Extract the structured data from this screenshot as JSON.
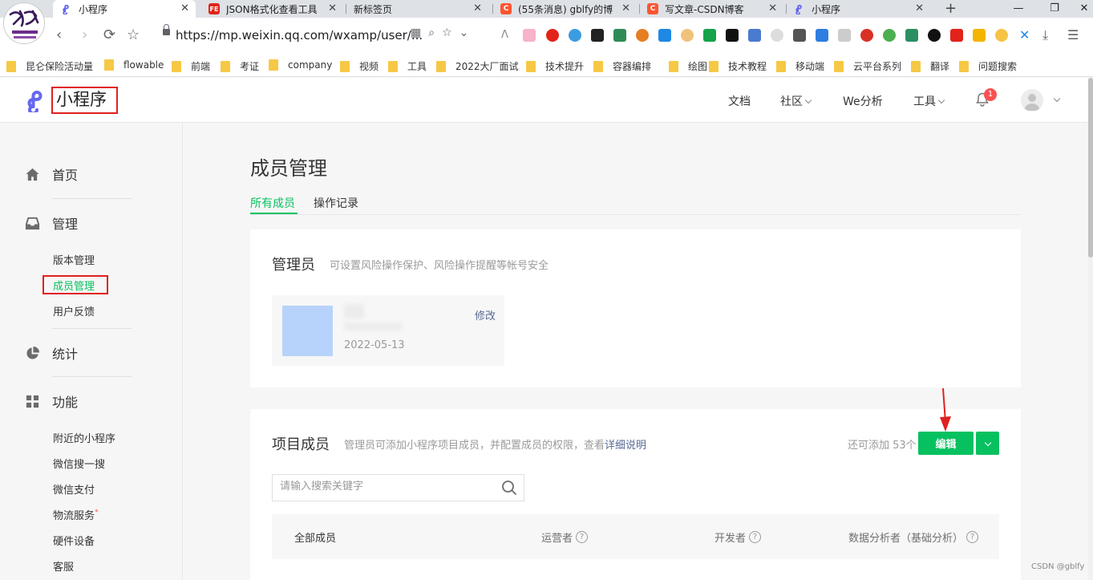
{
  "browser": {
    "tabs": [
      {
        "title": "小程序",
        "favicon_color": "#6467f0"
      },
      {
        "title": "JSON格式化查看工具",
        "favicon_color": "#e2231a",
        "favicon_text": "FE"
      },
      {
        "title": "新标签页",
        "favicon_color": ""
      },
      {
        "title": "(55条消息) gblfy的博",
        "favicon_color": "#fc5531",
        "favicon_text": "C"
      },
      {
        "title": "写文章-CSDN博客",
        "favicon_color": "#fc5531",
        "favicon_text": "C"
      },
      {
        "title": "小程序",
        "favicon_color": "#6467f0"
      }
    ],
    "new_tab": "+",
    "window_controls": {
      "minimize": "—",
      "maximize": "❐",
      "close": "✕"
    },
    "url": "https://mp.weixin.qq.com/wxamp/user/...",
    "bookmarks": [
      "昆仑保险活动量",
      "flowable",
      "前端",
      "考证",
      "company",
      "视频",
      "工具",
      "2022大厂面试",
      "技术提升",
      "容器编排",
      "绘图",
      "技术教程",
      "移动端",
      "云平台系列",
      "翻译",
      "问题搜索"
    ]
  },
  "header": {
    "logo_text": "小程序",
    "nav": [
      "文档",
      "社区",
      "We分析",
      "工具"
    ],
    "notification_count": "1",
    "brand_color": "#6467f0"
  },
  "sidebar": {
    "home": "首页",
    "manage": {
      "title": "管理",
      "items": [
        "版本管理",
        "成员管理",
        "用户反馈"
      ],
      "active": "成员管理"
    },
    "stats": "统计",
    "features": {
      "title": "功能",
      "items": [
        "附近的小程序",
        "微信搜一搜",
        "微信支付",
        "物流服务",
        "硬件设备",
        "客服"
      ],
      "dot_marker": "*"
    }
  },
  "main": {
    "title": "成员管理",
    "tabs": [
      "所有成员",
      "操作记录"
    ],
    "active_tab": "所有成员",
    "admin_card": {
      "title": "管理员",
      "subtitle": "可设置风险操作保护、风险操作提醒等帐号安全",
      "date": "2022-05-13",
      "edit": "修改"
    },
    "members_card": {
      "title": "项目成员",
      "subtitle": "管理员可添加小程序项目成员，并配置成员的权限，查看",
      "link": "详细说明",
      "remaining": "还可添加 53个",
      "edit_button": "编辑",
      "search_placeholder": "请输入搜索关键字",
      "columns": [
        "全部成员",
        "运营者",
        "开发者",
        "数据分析者（基础分析）"
      ]
    },
    "accent_color": "#07c160",
    "highlight_color": "#e02020"
  },
  "watermark": "CSDN @gblfy"
}
